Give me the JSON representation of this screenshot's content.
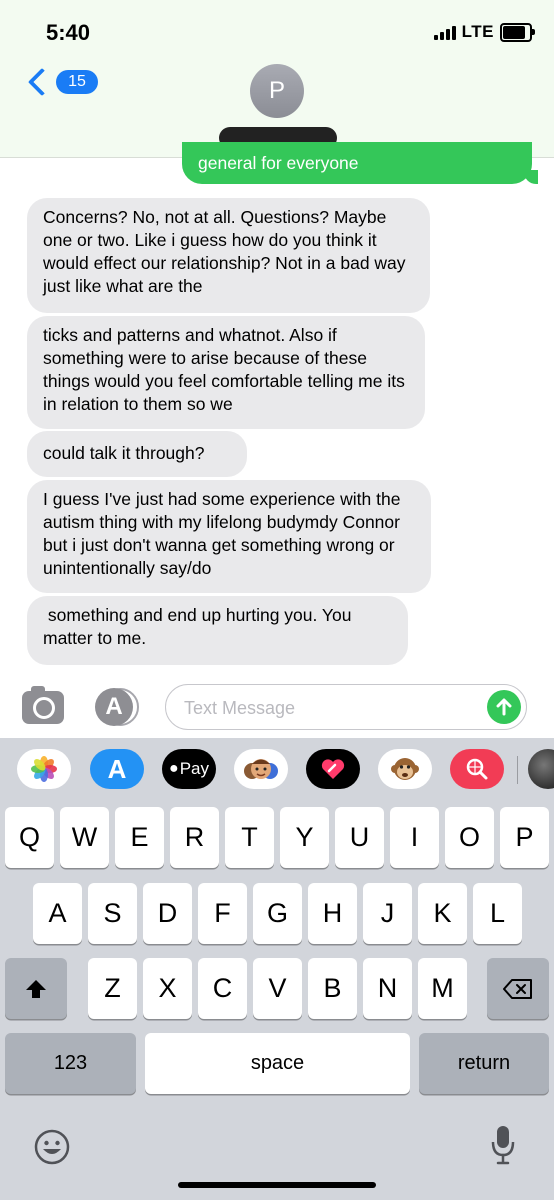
{
  "status_bar": {
    "time": "5:40",
    "network": "LTE",
    "battery_level": 0.85
  },
  "header": {
    "back_badge": "15",
    "contact_initial": "P"
  },
  "conversation": {
    "sent_partial": "general for everyone",
    "received": [
      "Concerns? No, not at all. Questions? Maybe one or two. Like i guess how do you think it would effect our relationship? Not in a bad way just like what are the",
      "ticks and patterns and whatnot. Also if something were to arise because of these things would you feel comfortable telling me its in relation to them so we",
      "could talk it through?",
      "I guess I've just had some experience with the autism thing with my lifelong budymdy Connor but i just don't wanna get something wrong or unintentionally say/do",
      " something and end up hurting you. You matter to me."
    ]
  },
  "input_bar": {
    "placeholder": "Text Message",
    "value": ""
  },
  "app_strip": {
    "icons": [
      "photos-icon",
      "app-store-icon",
      "apple-pay-icon",
      "memoji-icon",
      "digital-touch-icon",
      "animoji-monkey-icon",
      "images-search-icon",
      "music-icon"
    ],
    "apple_pay_label": "Pay"
  },
  "keyboard": {
    "row1": [
      "Q",
      "W",
      "E",
      "R",
      "T",
      "Y",
      "U",
      "I",
      "O",
      "P"
    ],
    "row2": [
      "A",
      "S",
      "D",
      "F",
      "G",
      "H",
      "J",
      "K",
      "L"
    ],
    "row3": [
      "Z",
      "X",
      "C",
      "V",
      "B",
      "N",
      "M"
    ],
    "numbers_label": "123",
    "space_label": "space",
    "return_label": "return"
  },
  "colors": {
    "ios_blue": "#1a7cf5",
    "imessage_green": "#34c759",
    "received_gray": "#e9e9eb",
    "keyboard_bg": "#d2d5db"
  }
}
